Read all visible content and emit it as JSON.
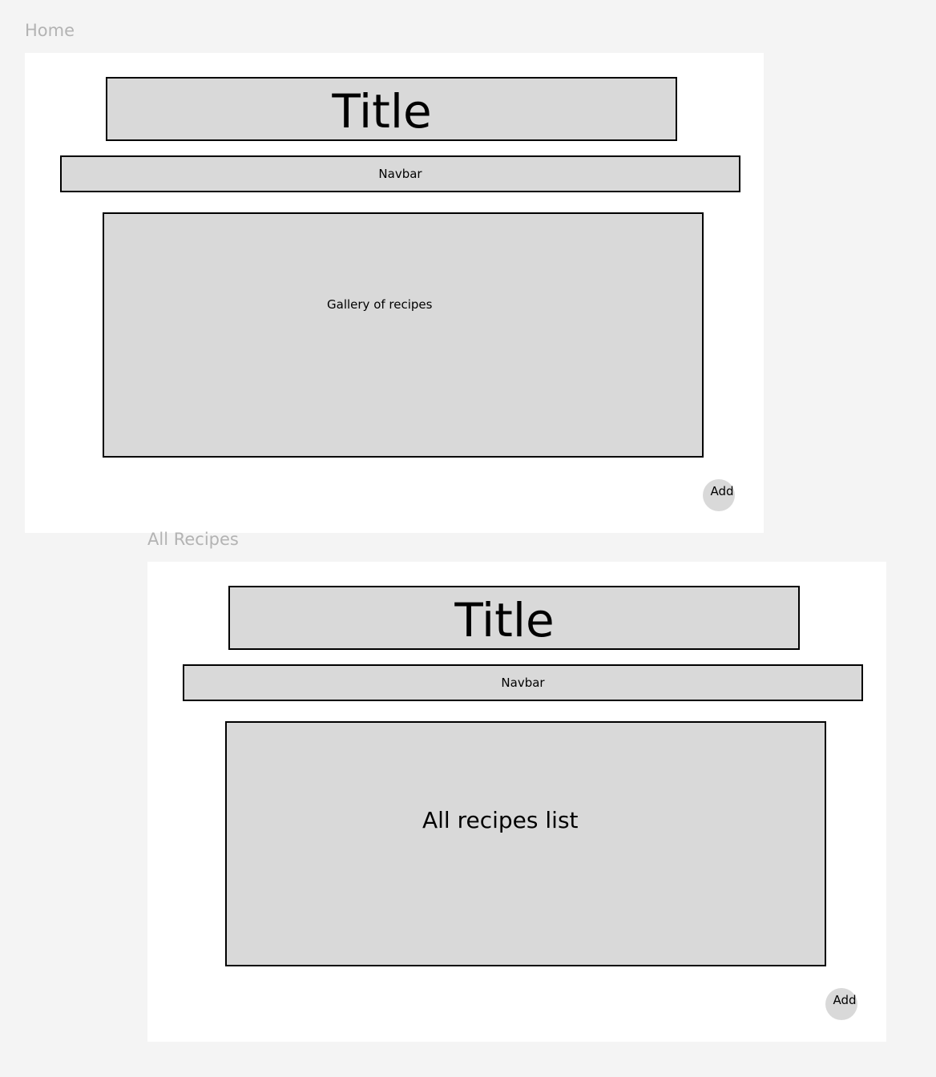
{
  "frames": [
    {
      "label": "Home",
      "title": "Title",
      "navbar": "Navbar",
      "content": "Gallery of recipes",
      "add_button": "Add"
    },
    {
      "label": "All Recipes",
      "title": "Title",
      "navbar": "Navbar",
      "content": "All recipes list",
      "add_button": "Add"
    }
  ],
  "colors": {
    "canvas": "#f4f4f4",
    "frame": "#ffffff",
    "placeholder_fill": "#d9d9d9",
    "border": "#000000",
    "frame_label": "#b3b3b3"
  }
}
